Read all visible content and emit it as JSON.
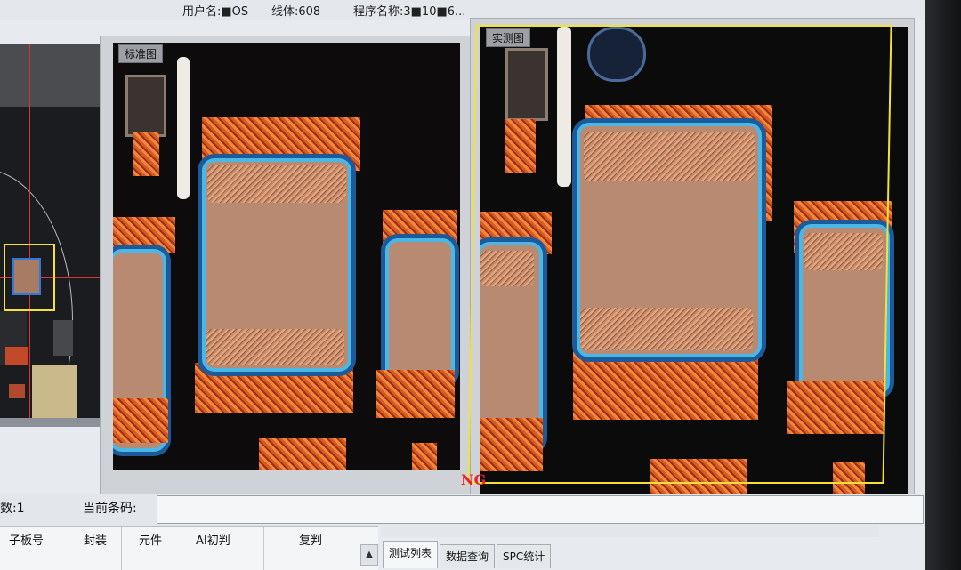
{
  "header": {
    "user": "用户名:■OS",
    "line": "线体:608",
    "program": "程序名称:3■10■6..."
  },
  "images": {
    "standard_label": "标准图",
    "actual_label": "实测图",
    "result_mark": "NG"
  },
  "bottom": {
    "count_label": "数:1",
    "barcode_label": "当前条码:",
    "barcode_value": ""
  },
  "table": {
    "columns": [
      "子板号",
      "封装",
      "元件",
      "AI初判",
      "复判"
    ]
  },
  "tabs": [
    "测试列表",
    "数据查询",
    "SPC统计"
  ],
  "colors": {
    "roi": "#f1e23a",
    "ng": "#ee2222",
    "crosshair": "#dd3333"
  }
}
